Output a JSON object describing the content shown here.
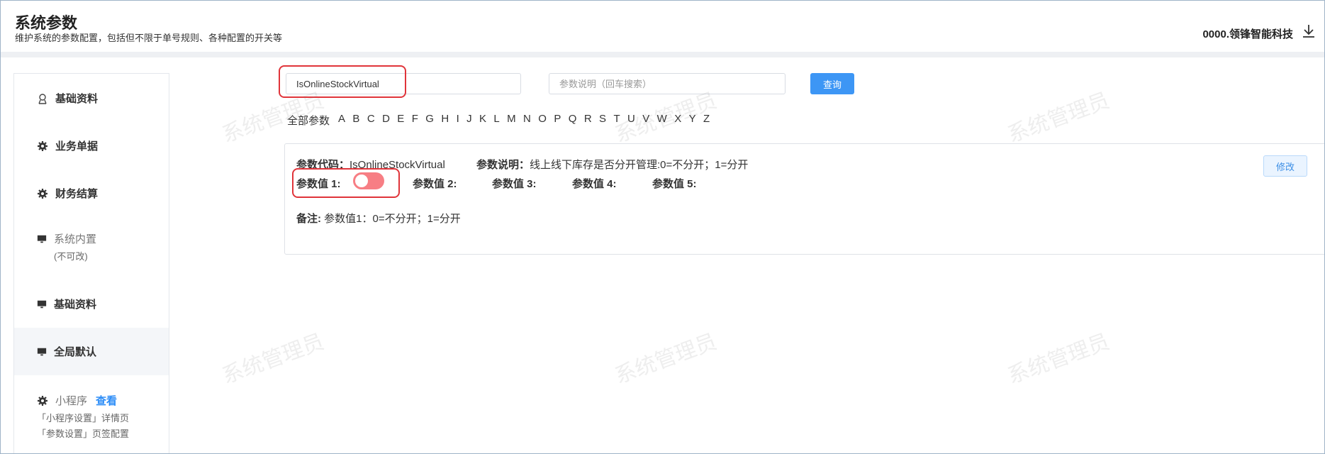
{
  "header": {
    "title": "系统参数",
    "subtitle": "维护系统的参数配置，包括但不限于单号规则、各种配置的开关等",
    "company": "0000.领锋智能科技"
  },
  "sidebar": {
    "items": [
      {
        "label": "基础资料",
        "icon": "user-badge-icon"
      },
      {
        "label": "业务单据",
        "icon": "gear-icon"
      },
      {
        "label": "财务结算",
        "icon": "gear-icon"
      },
      {
        "label": "系统内置",
        "sub": "(不可改)",
        "icon": "monitor-icon"
      },
      {
        "label": "基础资料",
        "icon": "monitor-icon"
      },
      {
        "label": "全局默认",
        "icon": "monitor-icon"
      },
      {
        "label": "小程序",
        "link": "查看",
        "sub1": "「小程序设置」详情页",
        "sub2": "「参数设置」页签配置",
        "icon": "gear-icon"
      }
    ]
  },
  "search": {
    "code_value": "IsOnlineStockVirtual",
    "desc_placeholder": "参数说明（回车搜索）",
    "query_label": "查询"
  },
  "letters": [
    "全部参数",
    "A",
    "B",
    "C",
    "D",
    "E",
    "F",
    "G",
    "H",
    "I",
    "J",
    "K",
    "L",
    "M",
    "N",
    "O",
    "P",
    "Q",
    "R",
    "S",
    "T",
    "U",
    "V",
    "W",
    "X",
    "Y",
    "Z"
  ],
  "card": {
    "code_label": "参数代码：",
    "code_value": "IsOnlineStockVirtual",
    "desc_label": "参数说明：",
    "desc_value": "线上线下库存是否分开管理:0=不分开；1=分开",
    "value1_label": "参数值 1:",
    "value2_label": "参数值 2:",
    "value3_label": "参数值 3:",
    "value4_label": "参数值 4:",
    "value5_label": "参数值 5:",
    "remark_label": "备注:",
    "remark_value": "参数值1：0=不分开；1=分开",
    "edit_label": "修改",
    "toggle_on": false,
    "toggle_color": "#f77e84"
  },
  "watermark": "系统管理员",
  "colors": {
    "primary": "#3d96f5",
    "highlight": "#e0343a"
  }
}
